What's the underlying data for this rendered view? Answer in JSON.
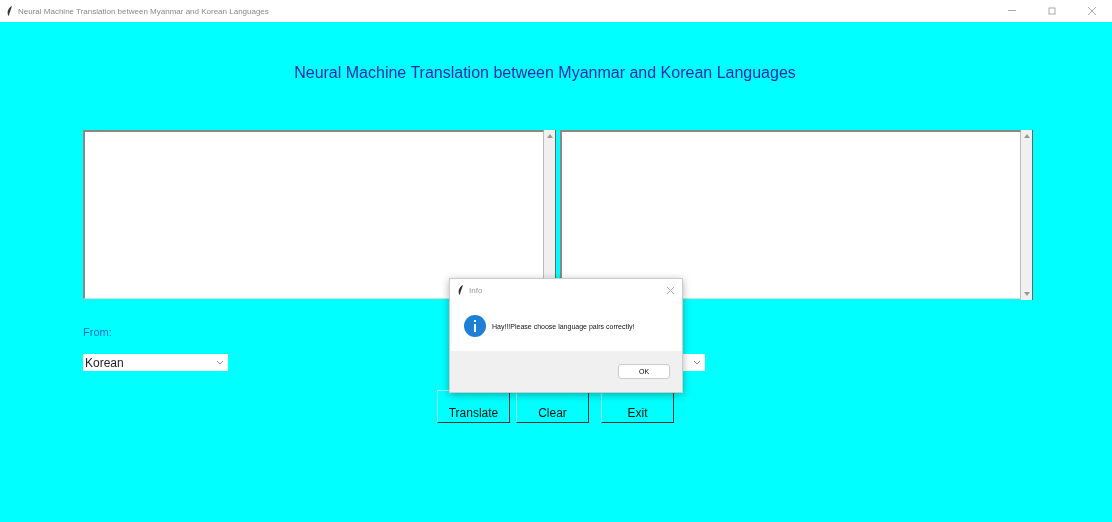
{
  "window": {
    "title": "Neural Machine Translation between Myanmar and Korean Languages"
  },
  "heading": "Neural Machine Translation between Myanmar and Korean Languages",
  "source_label": "From:",
  "source_language": "Korean",
  "buttons": [
    {
      "label": "Translate"
    },
    {
      "label": "Clear"
    },
    {
      "label": "Exit"
    }
  ],
  "dialog": {
    "title": "Info",
    "message": "Hay!!!Please choose language pairs correctly!",
    "button": "OK"
  }
}
